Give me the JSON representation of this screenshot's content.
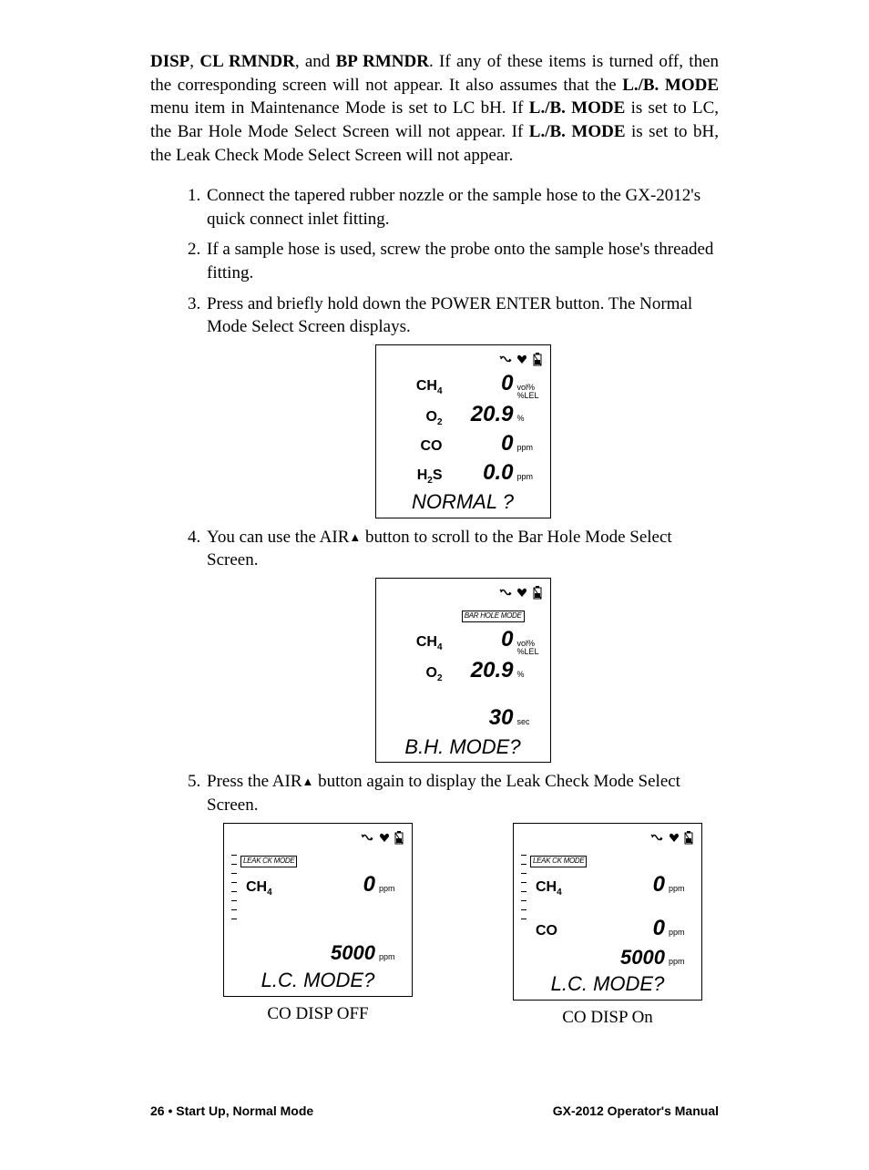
{
  "intro": {
    "kw_disp": "DISP",
    "kw_cl": "CL RMNDR",
    "kw_bp": "BP RMNDR",
    "txt1a": ", ",
    "txt1b": ", and ",
    "txt1c": ". If any of these items is turned off, then the corresponding screen will not appear. It also assumes that the ",
    "kw_lb1": "L./B. MODE",
    "txt2": " menu item in Maintenance Mode is set to LC bH. If ",
    "kw_lb2": "L./B. MODE",
    "txt3": " is set to LC, the Bar Hole Mode Select Screen will not appear. If ",
    "kw_lb3": "L./B. MODE",
    "txt4": " is set to bH, the Leak Check Mode Select Screen will not appear."
  },
  "steps": {
    "s1": "Connect the tapered rubber nozzle or the sample hose to the GX-2012's quick connect inlet fitting.",
    "s2": "If a sample hose is used, screw the probe onto the sample hose's threaded fitting.",
    "s3": "Press and briefly hold down the POWER ENTER button. The Normal Mode Select Screen displays.",
    "s4a": "You can use the AIR",
    "s4b": " button to scroll to the Bar Hole Mode Select Screen.",
    "s5a": "Press the AIR",
    "s5b": " button again to display the Leak Check Mode Select Screen."
  },
  "lcd_normal": {
    "rows": [
      {
        "label": "CH",
        "sub": "4",
        "val": "0",
        "unit_top": "vol%",
        "unit_bot": "%LEL"
      },
      {
        "label": "O",
        "sub": "2",
        "val": "20.9",
        "unit": "%"
      },
      {
        "label": "CO",
        "sub": "",
        "val": "0",
        "unit": "ppm"
      },
      {
        "label": "H",
        "sub": "2",
        "label2": "S",
        "val": "0.0",
        "unit": "ppm"
      }
    ],
    "footer": "NORMAL ?"
  },
  "lcd_bh": {
    "mode": "BAR HOLE MODE",
    "rows": [
      {
        "label": "CH",
        "sub": "4",
        "val": "0",
        "unit_top": "vol%",
        "unit_bot": "%LEL"
      },
      {
        "label": "O",
        "sub": "2",
        "val": "20.9",
        "unit": "%"
      }
    ],
    "sec_val": "30",
    "sec_unit": "sec",
    "footer": "B.H. MODE?"
  },
  "lcd_lc_off": {
    "mode": "LEAK CK MODE",
    "rows": [
      {
        "label": "CH",
        "sub": "4",
        "val": "0",
        "unit": "ppm"
      }
    ],
    "bottom_val": "5000",
    "bottom_unit": "ppm",
    "footer": "L.C. MODE?",
    "caption": "CO DISP OFF"
  },
  "lcd_lc_on": {
    "mode": "LEAK CK MODE",
    "rows": [
      {
        "label": "CH",
        "sub": "4",
        "val": "0",
        "unit": "ppm"
      },
      {
        "label": "CO",
        "sub": "",
        "val": "0",
        "unit": "ppm"
      }
    ],
    "bottom_val": "5000",
    "bottom_unit": "ppm",
    "footer": "L.C. MODE?",
    "caption": "CO DISP On"
  },
  "footer": {
    "left": "26 • Start Up, Normal Mode",
    "right": "GX-2012 Operator's Manual"
  },
  "icons": {
    "triangle": "▲"
  }
}
